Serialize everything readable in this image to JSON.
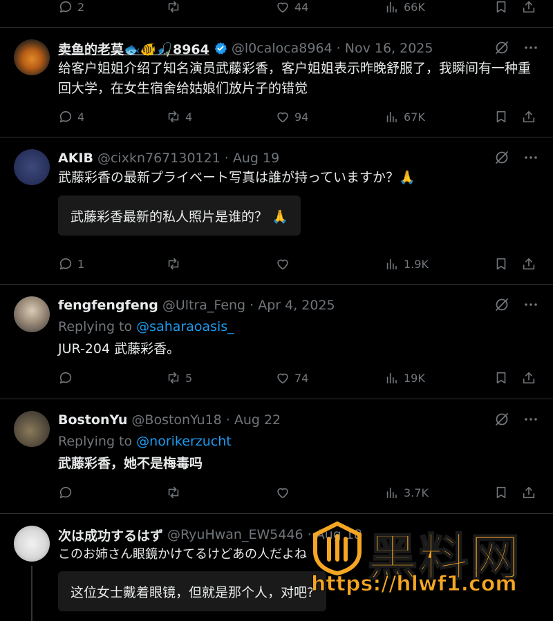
{
  "top_actions": {
    "replies": "2",
    "retweets": "",
    "likes": "44",
    "views": "66K"
  },
  "tweets": [
    {
      "display_name": "卖鱼的老莫🐟🐠🎣8964",
      "handle": "@l0caloca8964",
      "date": "· Nov 16, 2025",
      "verified": true,
      "text": "给客户姐姐介绍了知名演员武藤彩香，客户姐姐表示昨晚舒服了，我瞬间有一种重回大学，在女生宿舍给姑娘们放片子的错觉",
      "replies": "4",
      "retweets": "4",
      "likes": "94",
      "views": "67K"
    },
    {
      "display_name": "AKIB",
      "handle": "@cixkn767130121",
      "date": "· Aug 19",
      "text": "武藤彩香の最新プライベート写真は誰が持っていますか？🙏",
      "translation": "武藤彩香最新的私人照片是谁的？ 🙏",
      "replies": "1",
      "retweets": "",
      "likes": "",
      "views": "1.9K"
    },
    {
      "display_name": "fengfengfeng",
      "handle": "@Ultra_Feng",
      "date": "· Apr 4, 2025",
      "replying_label": "Replying to",
      "replying_to": "@saharaoasis_",
      "text": "JUR-204 武藤彩香。",
      "replies": "",
      "retweets": "5",
      "likes": "74",
      "views": "19K"
    },
    {
      "display_name": "BostonYu",
      "handle": "@BostonYu18",
      "date": "· Aug 22",
      "replying_label": "Replying to",
      "replying_to": "@norikerzucht",
      "text": "武藤彩香，她不是梅毒吗",
      "replies": "",
      "retweets": "",
      "likes": "",
      "views": "3.7K"
    },
    {
      "display_name": "次は成功するはず",
      "handle": "@RyuHwan_EW5446",
      "date": "· Aug 18",
      "text": "このお姉さん眼鏡かけてるけどあの人だよね",
      "translation": "这位女士戴着眼镜，但就是那个人，对吧?"
    }
  ],
  "watermark": {
    "title": "黑料网",
    "url": "https://hlwf1.com"
  },
  "colors": {
    "background": "#000000",
    "text": "#e7e9ea",
    "muted": "#71767b",
    "link": "#1d9bf0",
    "verified": "#1d9bf0",
    "watermark": "#f5a623"
  }
}
